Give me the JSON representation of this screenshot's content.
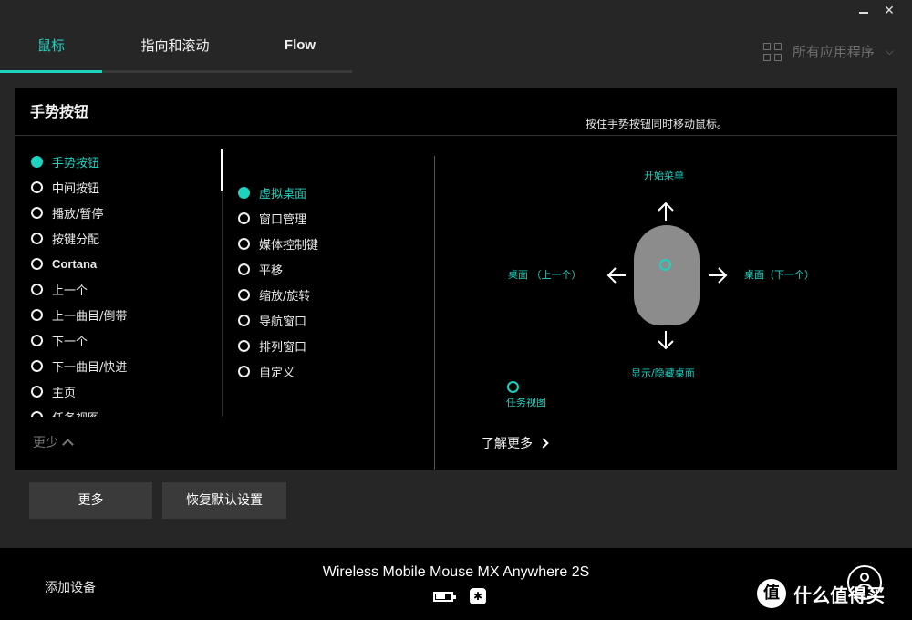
{
  "window": {
    "minimize": "",
    "close": "✕"
  },
  "tabs": [
    {
      "label": "鼠标",
      "active": true
    },
    {
      "label": "指向和滚动",
      "active": false
    },
    {
      "label": "Flow",
      "active": false
    }
  ],
  "app_select": {
    "label": "所有应用程序"
  },
  "panel": {
    "title": "手势按钮",
    "hint": "按住手势按钮同时移动鼠标。",
    "list1": [
      {
        "label": "手势按钮",
        "selected": true
      },
      {
        "label": "中间按钮"
      },
      {
        "label": "播放/暂停"
      },
      {
        "label": "按键分配"
      },
      {
        "label": "Cortana"
      },
      {
        "label": "上一个"
      },
      {
        "label": "上一曲目/倒带"
      },
      {
        "label": "下一个"
      },
      {
        "label": "下一曲目/快进"
      },
      {
        "label": "主页"
      },
      {
        "label": "任务视图"
      }
    ],
    "list2": [
      {
        "label": "虚拟桌面",
        "selected": true
      },
      {
        "label": "窗口管理"
      },
      {
        "label": "媒体控制键"
      },
      {
        "label": "平移"
      },
      {
        "label": "缩放/旋转"
      },
      {
        "label": "导航窗口"
      },
      {
        "label": "排列窗口"
      },
      {
        "label": "自定义"
      }
    ],
    "less_label": "更少",
    "gestures": {
      "up": "开始菜单",
      "left": "桌面 （上一个）",
      "right": "桌面（下一个）",
      "down": "显示/隐藏桌面",
      "click": "任务视图"
    },
    "learn_more": "了解更多"
  },
  "buttons": {
    "more": "更多",
    "restore": "恢复默认设置"
  },
  "footer": {
    "add_device": "添加设备",
    "device_name": "Wireless Mobile Mouse MX Anywhere 2S",
    "battery_level": 0.6,
    "bluetooth_glyph": "✱",
    "watermark_badge": "值",
    "watermark_text": "什么值得买"
  },
  "colors": {
    "accent": "#1fd2c0",
    "background": "#262626",
    "panel": "#000000"
  }
}
